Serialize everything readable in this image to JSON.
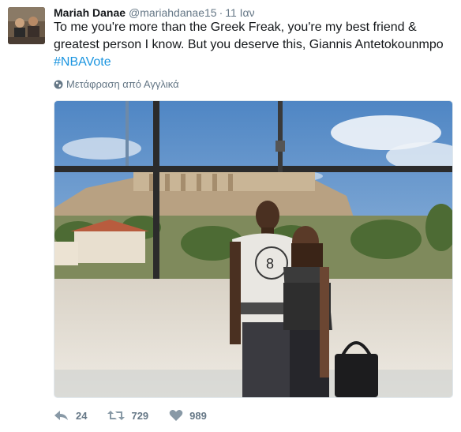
{
  "tweet": {
    "author_name": "Mariah Danae",
    "handle": "@mariahdanae15",
    "separator": "·",
    "time": "11 Ιαν",
    "text_main": "To me you're more than the Greek Freak, you're my best friend & greatest person I know. But you deserve this, Giannis Antetokounmpo",
    "hashtag": "#NBAVote",
    "translate_label": "Μετάφραση από Αγγλικά",
    "icons": {
      "globe": "globe-icon",
      "reply": "reply-icon",
      "retweet": "retweet-icon",
      "like": "heart-icon"
    },
    "actions": {
      "reply_count": "24",
      "retweet_count": "729",
      "like_count": "989"
    },
    "colors": {
      "text": "#14171a",
      "secondary": "#657786",
      "link": "#1b95e0"
    }
  }
}
